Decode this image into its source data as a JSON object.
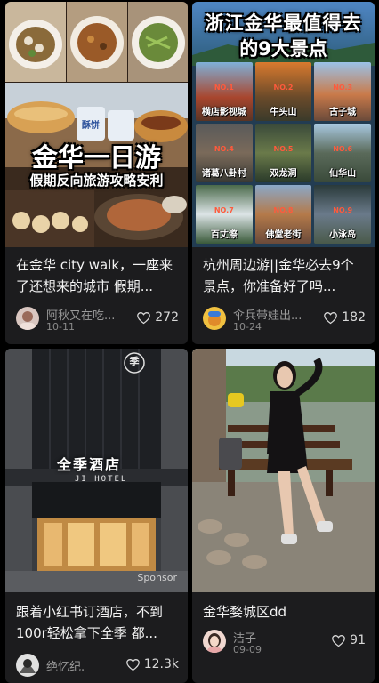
{
  "feed": {
    "cards": [
      {
        "cover_title": "金华一日游",
        "cover_subtitle": "假期反向旅游攻略安利",
        "title": "在金华 city walk，一座来了还想来的城市 假期...",
        "author": "阿秋又在吃...",
        "date": "10-11",
        "likes": "272"
      },
      {
        "cover_title_line1": "浙江金华最值得去",
        "cover_title_line2": "的9大景点",
        "spots": [
          {
            "no": "NO.1",
            "name": "横店影视城"
          },
          {
            "no": "NO.2",
            "name": "牛头山"
          },
          {
            "no": "NO.3",
            "name": "古子城"
          },
          {
            "no": "NO.4",
            "name": "诸葛八卦村"
          },
          {
            "no": "NO.5",
            "name": "双龙洞"
          },
          {
            "no": "NO.6",
            "name": "仙华山"
          },
          {
            "no": "NO.7",
            "name": "百丈漈"
          },
          {
            "no": "NO.8",
            "name": "佛堂老街"
          },
          {
            "no": "NO.9",
            "name": "小泳岛"
          }
        ],
        "title": "杭州周边游||金华必去9个景点，你准备好了吗...",
        "author": "伞兵带娃出...",
        "date": "10-24",
        "likes": "182"
      },
      {
        "hotel_logo": "季",
        "hotel_name": "全季酒店",
        "hotel_english": "JI HOTEL",
        "sponsor": "Sponsor",
        "title": "跟着小红书订酒店，不到100r轻松拿下全季 都...",
        "author": "绝忆纪.",
        "date": "",
        "likes": "12.3k"
      },
      {
        "title": "金华婺城区dd",
        "author": "洁子",
        "date": "09-09",
        "likes": "91"
      }
    ]
  },
  "icons": {
    "like": "heart-outline-icon"
  }
}
